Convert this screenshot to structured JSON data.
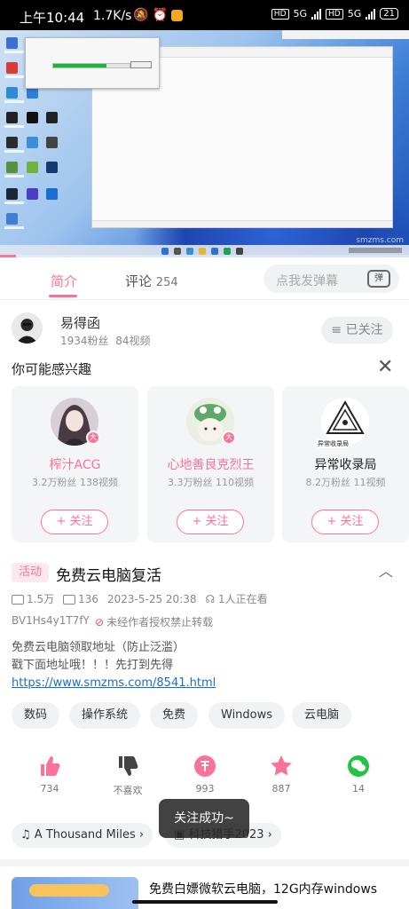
{
  "status_bar": {
    "time": "上午10:44",
    "speed": "1.7K/s",
    "signal_labels": [
      "HD",
      "5G",
      "HD",
      "5G"
    ],
    "battery": "21"
  },
  "player": {
    "watermark": "smzms.com",
    "dialog_progress": 0.7,
    "play_progress": 0.04
  },
  "tabs": {
    "intro": "简介",
    "comments": "评论",
    "comments_count": "254"
  },
  "danmaku": {
    "placeholder": "点我发弹幕",
    "button_icon": "弹"
  },
  "uploader": {
    "name": "易得函",
    "fans": "1934粉丝",
    "videos": "84视频",
    "follow_state": "已关注"
  },
  "recommend": {
    "title": "你可能感兴趣",
    "follow_label": "+ 关注",
    "cards": [
      {
        "name": "榨汁ACG",
        "stats": "3.2万粉丝 138视频",
        "badge": "大",
        "name_color": "#fb7299"
      },
      {
        "name": "心地善良克烈王",
        "stats": "3.3万粉丝 110视频",
        "badge": "大",
        "name_color": "#fb7299"
      },
      {
        "name": "异常收录局",
        "stats": "8.2万粉丝 11视频",
        "logo_text": "异常收录局",
        "name_color": "#222222"
      }
    ]
  },
  "video": {
    "activity_tag": "活动",
    "title": "免费云电脑复活",
    "plays": "1.5万",
    "danmaku_count": "136",
    "date": "2023-5-25 20:38",
    "watching": "1人正在看",
    "bvid": "BV1Hs4y1T7fY",
    "reprint_notice": "未经作者授权禁止转载",
    "desc_line1": "免费云电脑领取地址（防止泛滥）",
    "desc_line2": "戳下面地址哦！！！先打到先得",
    "desc_link": "https://www.smzms.com/8541.html"
  },
  "tags": [
    "数码",
    "操作系统",
    "免费",
    "Windows",
    "云电脑"
  ],
  "actions": [
    {
      "label": "734",
      "icon": "thumb-up-icon"
    },
    {
      "label": "不喜欢",
      "icon": "thumb-down-icon"
    },
    {
      "label": "993",
      "icon": "coin-icon"
    },
    {
      "label": "887",
      "icon": "star-icon"
    },
    {
      "label": "14",
      "icon": "wechat-icon"
    }
  ],
  "toast": "关注成功~",
  "music_pill": "A Thousand Miles",
  "collection_pill": "科技猎手2023",
  "related": {
    "title": "免费白嫖微软云电脑，12G内存windows"
  },
  "colors": {
    "accent": "#fb7299",
    "link": "#1a6fc4"
  }
}
